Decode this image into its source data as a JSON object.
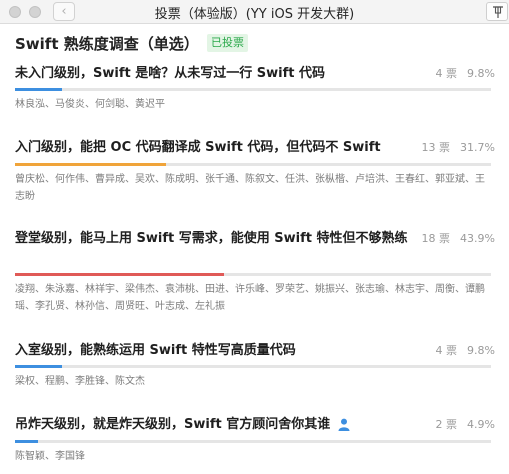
{
  "window": {
    "title": "投票（体验版）(YY iOS 开发大群)",
    "back_glyph": "‹"
  },
  "survey": {
    "title": "Swift 熟练度调查（单选）",
    "voted_badge": "已投票"
  },
  "options": [
    {
      "label": "未入门级别，Swift 是啥？从未写过一行 Swift 代码",
      "votes": "4 票",
      "percent": "9.8%",
      "share": 0.098,
      "bar_color": "#3d8fe0",
      "voters": "林良泓、马俊炎、何剑聪、黄迟平"
    },
    {
      "label": "入门级别，能把 OC 代码翻译成 Swift 代码，但代码不 Swift",
      "votes": "13 票",
      "percent": "31.7%",
      "share": 0.317,
      "bar_color": "#f0a43a",
      "voters": "曾庆松、何作伟、曹异成、吴欢、陈成明、张千通、陈叙文、任洪、张枞楷、卢培洪、王春红、郭亚斌、王志盼"
    },
    {
      "label": "登堂级别，能马上用 Swift 写需求，能使用 Swift 特性但不够熟练",
      "votes": "18 票",
      "percent": "43.9%",
      "share": 0.439,
      "bar_color": "#e05a57",
      "voters": "凌翔、朱泳嘉、林祥宇、梁伟杰、袁沛桃、田进、许乐峰、罗荣艺、姚振兴、张志瑜、林志宇、周衡、谭鹏瑶、李孔贤、林孙信、周贤旺、叶志成、左礼振"
    },
    {
      "label": "入室级别，能熟练运用 Swift 特性写高质量代码",
      "votes": "4 票",
      "percent": "9.8%",
      "share": 0.098,
      "bar_color": "#3d8fe0",
      "voters": "梁权、程鹏、李胜锋、陈文杰"
    },
    {
      "label": "吊炸天级别，就是炸天级别，Swift 官方顾问舍你其谁",
      "votes": "2 票",
      "percent": "4.9%",
      "share": 0.049,
      "bar_color": "#3d8fe0",
      "voters": "陈智颖、李国锋",
      "icon": "user-icon"
    }
  ]
}
